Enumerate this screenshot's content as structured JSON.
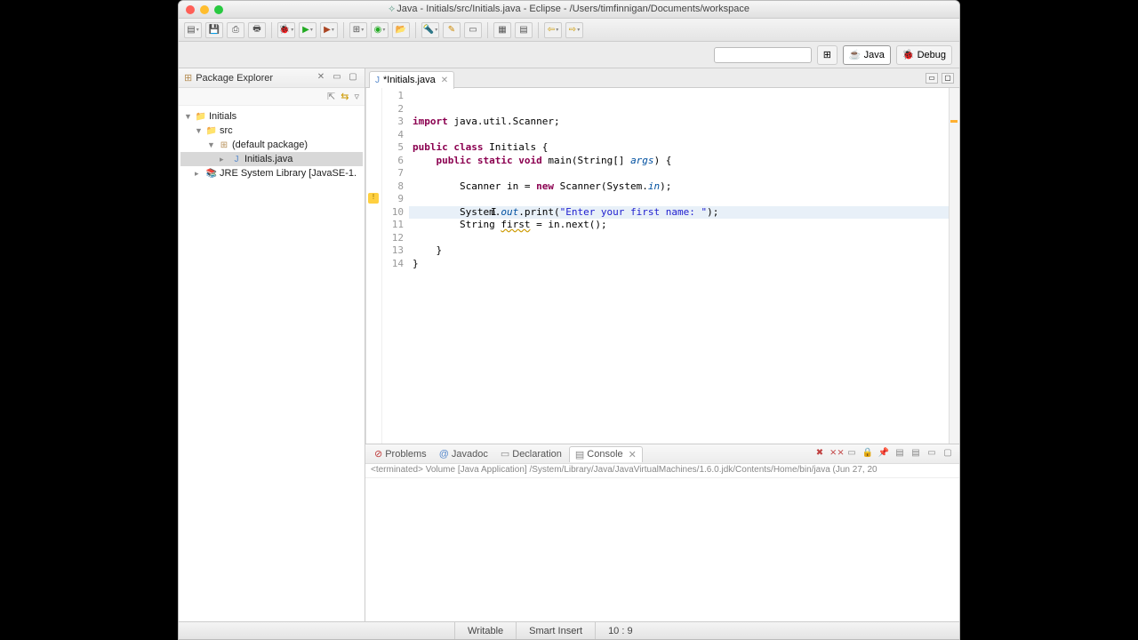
{
  "title": "Java - Initials/src/Initials.java - Eclipse - /Users/timfinnigan/Documents/workspace",
  "perspective": {
    "java": "Java",
    "debug": "Debug"
  },
  "package_explorer": {
    "title": "Package Explorer",
    "project": "Initials",
    "src": "src",
    "pkg": "(default package)",
    "file": "Initials.java",
    "lib": "JRE System Library [JavaSE-1."
  },
  "editor": {
    "tab": "*Initials.java",
    "lines": [
      "1",
      "2",
      "3",
      "4",
      "5",
      "6",
      "7",
      "8",
      "9",
      "10",
      "11",
      "12",
      "13",
      "14"
    ],
    "code": {
      "l1a": "import",
      "l1b": " java.util.Scanner;",
      "l3a": "public",
      "l3b": " class",
      "l3c": " Initials {",
      "l4a": "    public",
      "l4b": " static",
      "l4c": " void",
      "l4d": " main(String[] ",
      "l4e": "args",
      "l4f": ") {",
      "l6a": "        Scanner in = ",
      "l6b": "new",
      "l6c": " Scanner(System.",
      "l6d": "in",
      "l6e": ");",
      "l8a": "        System.",
      "l8b": "out",
      "l8c": ".print(",
      "l8d": "\"Enter your first name: \"",
      "l8e": ");",
      "l9a": "        String ",
      "l9b": "first",
      "l9c": " = in.next();",
      "l12": "    }",
      "l13": "}"
    }
  },
  "bottom": {
    "tabs": {
      "problems": "Problems",
      "javadoc": "Javadoc",
      "declaration": "Declaration",
      "console": "Console"
    },
    "launch": "<terminated> Volume [Java Application] /System/Library/Java/JavaVirtualMachines/1.6.0.jdk/Contents/Home/bin/java (Jun 27, 20"
  },
  "status": {
    "writable": "Writable",
    "insert": "Smart Insert",
    "pos": "10 : 9"
  }
}
